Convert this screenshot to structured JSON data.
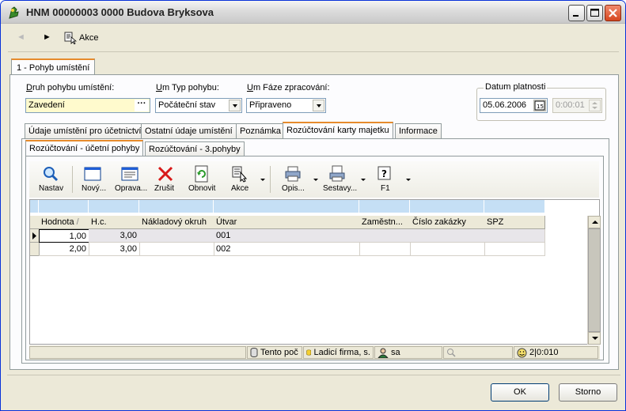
{
  "window": {
    "title": "HNM 00000003 0000 Budova Bryksova"
  },
  "toolbar": {
    "back_label": "◄",
    "forward_label": "►",
    "akce_label": "Akce"
  },
  "outer_tab": {
    "label": "1 - Pohyb umístění"
  },
  "form": {
    "druh_label_u": "D",
    "druh_label_rest": "ruh pohybu umístění:",
    "druh_value": "Zavedení",
    "typ_label_u": "U",
    "typ_label_rest": "m Typ pohybu:",
    "typ_value": "Počáteční stav",
    "faze_label_u": "U",
    "faze_label_rest": "m Fáze zpracování:",
    "faze_value": "Připraveno",
    "datum_legend": "Datum platnosti",
    "datum_value": "05.06.2006",
    "time_value": "0:00:01"
  },
  "inner_tabs": [
    {
      "label": "Údaje umístění pro účetnictví"
    },
    {
      "label": "Ostatní údaje umístění"
    },
    {
      "label": "Poznámka"
    },
    {
      "label": "Rozúčtování karty majetku"
    },
    {
      "label": "Informace"
    }
  ],
  "sub_tabs": [
    {
      "label": "Rozúčtování - účetní pohyby"
    },
    {
      "label": "Rozúčtování - 3.pohyby"
    }
  ],
  "grid_toolbar": [
    {
      "label": "Nastav",
      "icon": "magnifier-icon"
    },
    {
      "label": "Nový...",
      "icon": "new-window-icon"
    },
    {
      "label": "Oprava...",
      "icon": "edit-form-icon"
    },
    {
      "label": "Zrušit",
      "icon": "red-x-icon"
    },
    {
      "label": "Obnovit",
      "icon": "refresh-icon"
    },
    {
      "label": "Akce",
      "icon": "action-cursor-icon"
    },
    {
      "label": "Opis...",
      "icon": "printer-icon"
    },
    {
      "label": "Sestavy...",
      "icon": "reports-icon"
    },
    {
      "label": "F1",
      "icon": "help-icon"
    }
  ],
  "grid": {
    "columns": [
      "Hodnota",
      "H.c.",
      "Nákladový okruh",
      "Útvar",
      "Zaměstn...",
      "Číslo zakázky",
      "SPZ"
    ],
    "sort_marker": "/",
    "rows": [
      [
        "1,00",
        "3,00",
        "",
        "001",
        "",
        "",
        ""
      ],
      [
        "2,00",
        "3,00",
        "",
        "002",
        "",
        "",
        ""
      ]
    ]
  },
  "statusbar": {
    "tento": "Tento poč",
    "firma": "Ladicí firma, s.",
    "user": "sa",
    "counter": "2|0:010"
  },
  "buttons": {
    "ok": "OK",
    "storno": "Storno"
  }
}
